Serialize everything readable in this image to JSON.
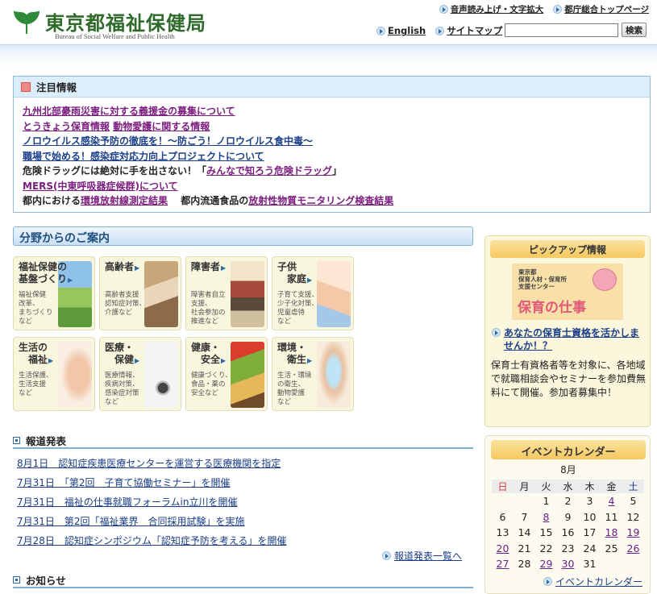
{
  "header": {
    "site_title": "東京都福祉保健局",
    "site_subtitle": "Bureau of Social Welfare and Public Health",
    "top_links": [
      "音声読み上げ・文字拡大",
      "都庁総合トップページ"
    ],
    "nav_links": [
      "English",
      "サイトマップ"
    ],
    "search_placeholder": "",
    "search_button": "検索"
  },
  "notice": {
    "title": "注目情報",
    "items": [
      {
        "parts": [
          {
            "text": "九州北部豪雨災害に対する義援金の募集について",
            "link": true
          }
        ]
      },
      {
        "parts": [
          {
            "text": "とうきょう保育情報",
            "link": true
          },
          {
            "text": " ",
            "link": false
          },
          {
            "text": "動物愛護に関する情報",
            "link": true
          }
        ]
      },
      {
        "parts": [
          {
            "text": "ノロウイルス感染予防の徹底を！～防ごう！ノロウイルス食中毒～",
            "link": true
          }
        ]
      },
      {
        "parts": [
          {
            "text": "職場で始める！感染症対応力向上プロジェクトについて",
            "link": true
          }
        ]
      },
      {
        "parts": [
          {
            "text": "危険ドラッグには絶対に手を出さない！「",
            "link": false
          },
          {
            "text": "みんなで知ろう危険ドラッグ",
            "link": true
          },
          {
            "text": "」",
            "link": false
          }
        ]
      },
      {
        "parts": [
          {
            "text": "MERS(中東呼吸器症候群)について",
            "link": true
          }
        ]
      },
      {
        "parts": [
          {
            "text": "都内における",
            "link": false
          },
          {
            "text": "環境放射線測定結果",
            "link": true
          },
          {
            "text": "　 都内流通食品の",
            "link": false
          },
          {
            "text": "放射性物質モニタリング検査結果",
            "link": true
          }
        ]
      }
    ]
  },
  "categories": {
    "heading": "分野からのご案内",
    "tiles": [
      {
        "title": "福祉保健の\n基盤づくり",
        "desc": "福祉保健\n改革、\nまちづくり\nなど"
      },
      {
        "title": "高齢者",
        "desc": "高齢者支援\n認知症対策、\n介護など"
      },
      {
        "title": "障害者",
        "desc": "障害者自立\n支援、\n社会参加の\n推進など"
      },
      {
        "title": "子供\n　家庭",
        "desc": "子育て支援、\n少子化対策、\n児童虐待\nなど"
      },
      {
        "title": "生活の\n　福祉",
        "desc": "生活保護、\n生活支援\nなど"
      },
      {
        "title": "医療・\n　保健",
        "desc": "医療情報、\n疾病対策、\n感染症対策\nなど"
      },
      {
        "title": "健康・\n　安全",
        "desc": "健康づくり、\n食品・薬の\n安全など"
      },
      {
        "title": "環境・\n　衛生",
        "desc": "生活・環境\nの衛生、\n動物愛護\nなど"
      }
    ]
  },
  "press": {
    "heading": "報道発表",
    "items": [
      "8月1日　認知症疾患医療センターを運営する医療機関を指定",
      "7月31日　「第2回　子育て協働セミナー」を開催",
      "7月31日　福祉の仕事就職フォーラムin立川を開催",
      "7月31日　第2回「福祉業界　合同採用試験」を実施",
      "7月28日　認知症シンポジウム「認知症予防を考える」を開催"
    ],
    "more": "報道発表一覧へ"
  },
  "oshirase": {
    "heading": "お知らせ"
  },
  "pickup": {
    "title": "ピックアップ情報",
    "banner_small": "東京都\n保育人材・保育所\n支援センター",
    "banner_big": "保育の仕事",
    "link": "あなたの保育士資格を活かしませんか！？",
    "text": "保育士有資格者等を対象に、各地域で就職相談会やセミナーを参加費無料にて開催。参加者募集中！"
  },
  "calendar": {
    "title": "イベントカレンダー",
    "month": "8月",
    "weekdays": [
      "日",
      "月",
      "火",
      "水",
      "木",
      "金",
      "土"
    ],
    "weeks": [
      [
        "",
        "",
        "1",
        "2",
        "3",
        "4",
        "5"
      ],
      [
        "6",
        "7",
        "8",
        "9",
        "10",
        "11",
        "12"
      ],
      [
        "13",
        "14",
        "15",
        "16",
        "17",
        "18",
        "19"
      ],
      [
        "20",
        "21",
        "22",
        "23",
        "24",
        "25",
        "26"
      ],
      [
        "27",
        "28",
        "29",
        "30",
        "31",
        "",
        ""
      ]
    ],
    "linked_days": [
      "4",
      "8",
      "18",
      "19",
      "20",
      "26",
      "27",
      "29",
      "30"
    ],
    "more": "イベントカレンダー"
  }
}
